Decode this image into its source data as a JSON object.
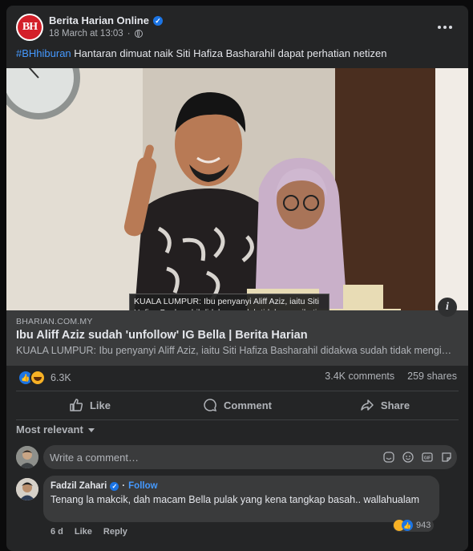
{
  "post": {
    "page_name": "Berita Harian Online",
    "avatar_text": "BH",
    "date": "18 March at 13:03",
    "separator": "·",
    "hashtag": "#BHhiburan",
    "caption": " Hantaran dimuat naik Siti Hafiza Basharahil dapat perhatian netizen"
  },
  "photo": {
    "overlay_text": "KUALA LUMPUR: Ibu penyanyi Aliff Aziz, iaitu Siti Hafiza Basharahil didakwa sudah tidak mengikuti atau ‘unfollow’ menantunya, Bella Astillah di Instagram (IG).",
    "info_label": "i"
  },
  "link": {
    "domain": "BHARIAN.COM.MY",
    "title": "Ibu Aliff Aziz sudah 'unfollow' IG Bella | Berita Harian",
    "description": "KUALA LUMPUR: Ibu penyanyi Aliff Aziz, iaitu Siti Hafiza Basharahil didakwa sudah tidak mengikuti atau ‘unfollow’ menantunya"
  },
  "stats": {
    "reactions": "6.3K",
    "comments": "3.4K comments",
    "shares": "259 shares"
  },
  "actions": {
    "like": "Like",
    "comment": "Comment",
    "share": "Share"
  },
  "comments_section": {
    "sort": "Most relevant",
    "placeholder": "Write a comment…",
    "icons": [
      "emoji-sticker-icon",
      "smiley-icon",
      "gif-icon",
      "sticker-icon"
    ]
  },
  "comment": {
    "author": "Fadzil Zahari",
    "follow": "Follow",
    "text": "Tenang la makcik, dah macam Bella pulak yang kena tangkap basah.. wallahualam",
    "reaction_count": "943",
    "time": "6 d",
    "like": "Like",
    "reply": "Reply"
  },
  "colors": {
    "background": "#242526",
    "accent": "#4599ff",
    "verified": "#1b74e4"
  }
}
